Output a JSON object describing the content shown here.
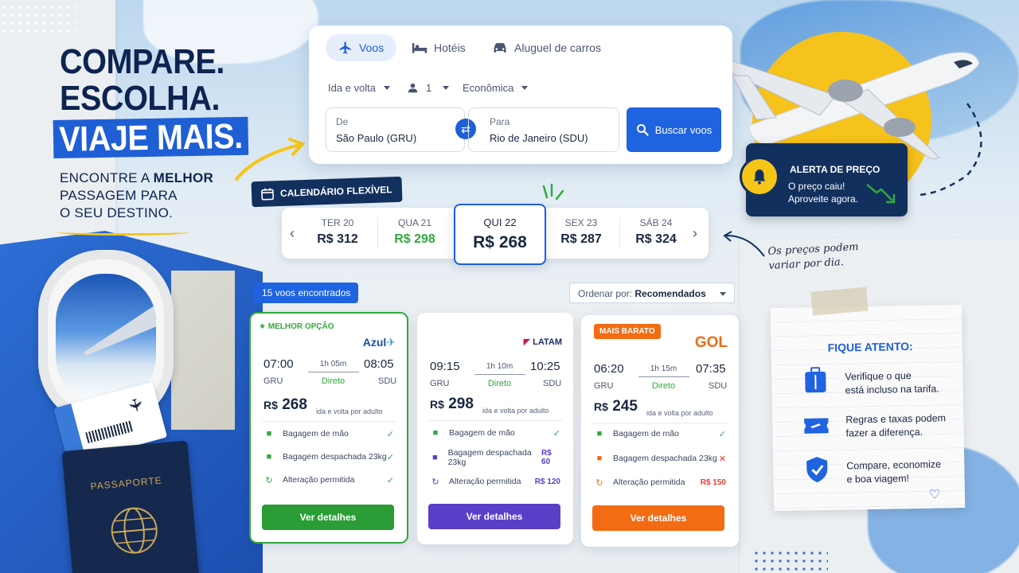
{
  "headline": {
    "line1": "COMPARE.",
    "line2": "ESCOLHA.",
    "line3": "VIAJE MAIS."
  },
  "subheadline": {
    "pre": "ENCONTRE A ",
    "bold": "MELHOR",
    "line2": "PASSAGEM PARA",
    "line3": "O SEU DESTINO."
  },
  "search": {
    "tabs": [
      {
        "label": "Voos",
        "icon": "plane-icon",
        "active": true
      },
      {
        "label": "Hotéis",
        "icon": "bed-icon",
        "active": false
      },
      {
        "label": "Aluguel de carros",
        "icon": "car-icon",
        "active": false
      }
    ],
    "trip_type": "Ida e volta",
    "passengers": "1",
    "cabin": "Econômica",
    "from_label": "De",
    "from_value": "São Paulo (GRU)",
    "to_label": "Para",
    "to_value": "Rio de Janeiro (SDU)",
    "button": "Buscar voos"
  },
  "calendar": {
    "badge": "CALENDÁRIO FLEXÍVEL",
    "days": [
      {
        "day": "TER 20",
        "price": "R$ 312"
      },
      {
        "day": "QUA 21",
        "price": "R$ 298"
      },
      {
        "day": "QUI 22",
        "price": "R$ 268"
      },
      {
        "day": "SEX 23",
        "price": "R$ 287"
      },
      {
        "day": "SÁB 24",
        "price": "R$ 324"
      }
    ],
    "note_line1": "Os preços podem",
    "note_line2": "variar por dia."
  },
  "price_alert": {
    "title": "ALERTA DE PREÇO",
    "line1": "O preço caiu!",
    "line2": "Aproveite agora."
  },
  "results": {
    "found": "15 voos encontrados",
    "sort_label": "Ordenar por:",
    "sort_value": "Recomendados",
    "colors": {
      "green": "#2faa3e",
      "purple": "#5b3ec8",
      "orange": "#f36b12",
      "red": "#e53935"
    },
    "flights": [
      {
        "tag": "MELHOR OPÇÃO",
        "airline": "Azul",
        "dep_time": "07:00",
        "dep_ap": "GRU",
        "duration": "1h 05m",
        "stops": "Direto",
        "arr_time": "08:05",
        "arr_ap": "SDU",
        "price_currency": "R$",
        "price_value": "268",
        "price_note": "ida e volta por adulto",
        "rows": [
          {
            "label": "Bagagem de mão",
            "status": "✓"
          },
          {
            "label": "Bagagem despachada 23kg",
            "status": "✓"
          },
          {
            "label": "Alteração permitida",
            "status": "✓"
          }
        ],
        "button": "Ver detalhes"
      },
      {
        "tag": "",
        "airline": "LATAM",
        "dep_time": "09:15",
        "dep_ap": "GRU",
        "duration": "1h 10m",
        "stops": "Direto",
        "arr_time": "10:25",
        "arr_ap": "SDU",
        "price_currency": "R$",
        "price_value": "298",
        "price_note": "ida e volta por adulto",
        "rows": [
          {
            "label": "Bagagem de mão",
            "status": "✓"
          },
          {
            "label": "Bagagem despachada 23kg",
            "status": "R$ 60"
          },
          {
            "label": "Alteração permitida",
            "status": "R$ 120"
          }
        ],
        "button": "Ver detalhes"
      },
      {
        "tag": "MAIS BARATO",
        "airline": "GOL",
        "dep_time": "06:20",
        "dep_ap": "GRU",
        "duration": "1h 15m",
        "stops": "Direto",
        "arr_time": "07:35",
        "arr_ap": "SDU",
        "price_currency": "R$",
        "price_value": "245",
        "price_note": "ida e volta por adulto",
        "rows": [
          {
            "label": "Bagagem de mão",
            "status": "✓"
          },
          {
            "label": "Bagagem despachada 23kg",
            "status": "✕"
          },
          {
            "label": "Alteração permitida",
            "status": "R$ 150"
          }
        ],
        "button": "Ver detalhes"
      }
    ]
  },
  "tips": {
    "title": "FIQUE ATENTO:",
    "items": [
      {
        "line1": "Verifique o que",
        "line2": "está incluso na tarifa.",
        "icon": "luggage-icon"
      },
      {
        "line1": "Regras e taxas podem",
        "line2": "fazer a diferença.",
        "icon": "ticket-icon"
      },
      {
        "line1": "Compare, economize",
        "line2": "e boa viagem!",
        "icon": "shield-check-icon"
      }
    ]
  },
  "passport_label": "PASSAPORTE"
}
